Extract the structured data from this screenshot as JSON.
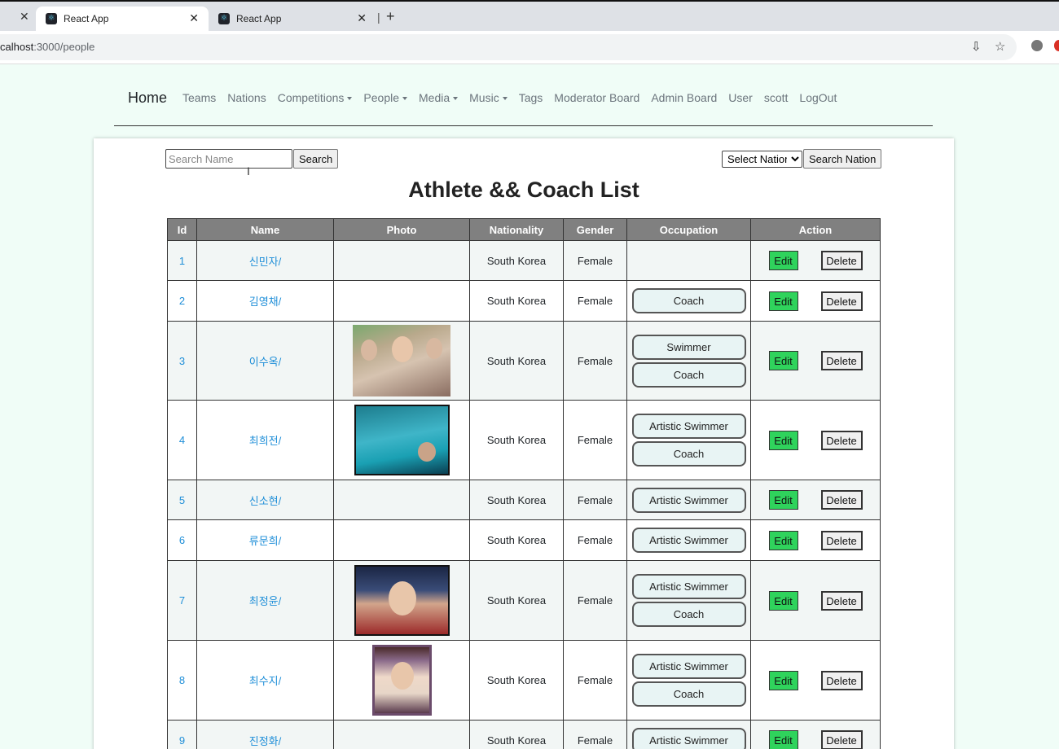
{
  "browser": {
    "tabs": [
      {
        "label": "React App",
        "active": true
      },
      {
        "label": "React App",
        "active": false
      }
    ],
    "url_dim_prefix": "calhost",
    "url_rest": ":3000/people"
  },
  "navbar": {
    "brand": "Home",
    "links": [
      "Teams",
      "Nations",
      "Competitions",
      "People",
      "Media",
      "Music",
      "Tags",
      "Moderator Board",
      "Admin Board",
      "User",
      "scott",
      "LogOut"
    ]
  },
  "search": {
    "placeholder": "Search Name",
    "button": "Search",
    "nation_selected": "Select Nation",
    "nation_button": "Search Nation"
  },
  "title": "Athlete && Coach List",
  "table": {
    "headers": [
      "Id",
      "Name",
      "Photo",
      "Nationality",
      "Gender",
      "Occupation",
      "Action"
    ],
    "edit_label": "Edit",
    "delete_label": "Delete",
    "rows": [
      {
        "id": "1",
        "name": "신민자/",
        "nationality": "South Korea",
        "gender": "Female",
        "occupations": []
      },
      {
        "id": "2",
        "name": "김영채/",
        "nationality": "South Korea",
        "gender": "Female",
        "occupations": [
          "Coach"
        ]
      },
      {
        "id": "3",
        "name": "이수옥/",
        "nationality": "South Korea",
        "gender": "Female",
        "occupations": [
          "Swimmer",
          "Coach"
        ]
      },
      {
        "id": "4",
        "name": "최희전/",
        "nationality": "South Korea",
        "gender": "Female",
        "occupations": [
          "Artistic Swimmer",
          "Coach"
        ]
      },
      {
        "id": "5",
        "name": "신소현/",
        "nationality": "South Korea",
        "gender": "Female",
        "occupations": [
          "Artistic Swimmer"
        ]
      },
      {
        "id": "6",
        "name": "류문희/",
        "nationality": "South Korea",
        "gender": "Female",
        "occupations": [
          "Artistic Swimmer"
        ]
      },
      {
        "id": "7",
        "name": "최정윤/",
        "nationality": "South Korea",
        "gender": "Female",
        "occupations": [
          "Artistic Swimmer",
          "Coach"
        ]
      },
      {
        "id": "8",
        "name": "최수지/",
        "nationality": "South Korea",
        "gender": "Female",
        "occupations": [
          "Artistic Swimmer",
          "Coach"
        ]
      },
      {
        "id": "9",
        "name": "진정화/",
        "nationality": "South Korea",
        "gender": "Female",
        "occupations": [
          "Artistic Swimmer"
        ]
      }
    ]
  }
}
